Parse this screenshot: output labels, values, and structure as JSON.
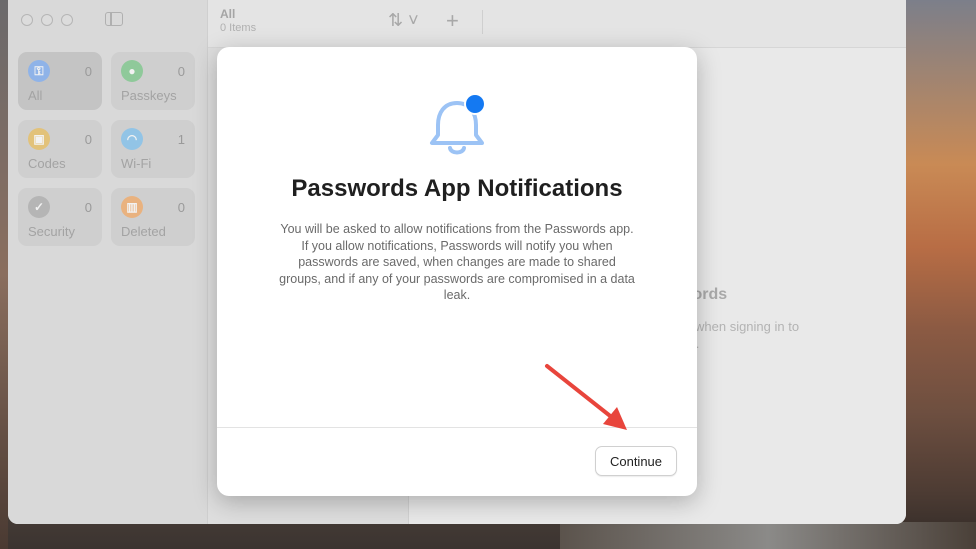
{
  "sidebar": {
    "tiles": [
      {
        "label": "All",
        "count": "0",
        "icon": "key-icon",
        "color": "#8fb3e8"
      },
      {
        "label": "Passkeys",
        "count": "0",
        "icon": "person-icon",
        "color": "#8fc99a"
      },
      {
        "label": "Codes",
        "count": "0",
        "icon": "lock-icon",
        "color": "#e2c27a"
      },
      {
        "label": "Wi-Fi",
        "count": "1",
        "icon": "wifi-icon",
        "color": "#92c4e6"
      },
      {
        "label": "Security",
        "count": "0",
        "icon": "checkmark-icon",
        "color": "#b5b5b5"
      },
      {
        "label": "Deleted",
        "count": "0",
        "icon": "trash-icon",
        "color": "#e9b27f"
      }
    ]
  },
  "list": {
    "title": "All",
    "subtitle": "0 Items"
  },
  "background_detail": {
    "heading_fragment": "words",
    "body_fragment": "ly when signing in to\nps."
  },
  "modal": {
    "title": "Passwords App Notifications",
    "body": "You will be asked to allow notifications from the Passwords app. If you allow notifications, Passwords will notify you when passwords are saved, when changes are made to shared groups, and if any of your passwords are compromised in a data leak.",
    "continue_label": "Continue",
    "bell_color": "#9cc3f5",
    "badge_color": "#1479f2"
  },
  "annotation": {
    "arrow_color": "#e8453c"
  }
}
